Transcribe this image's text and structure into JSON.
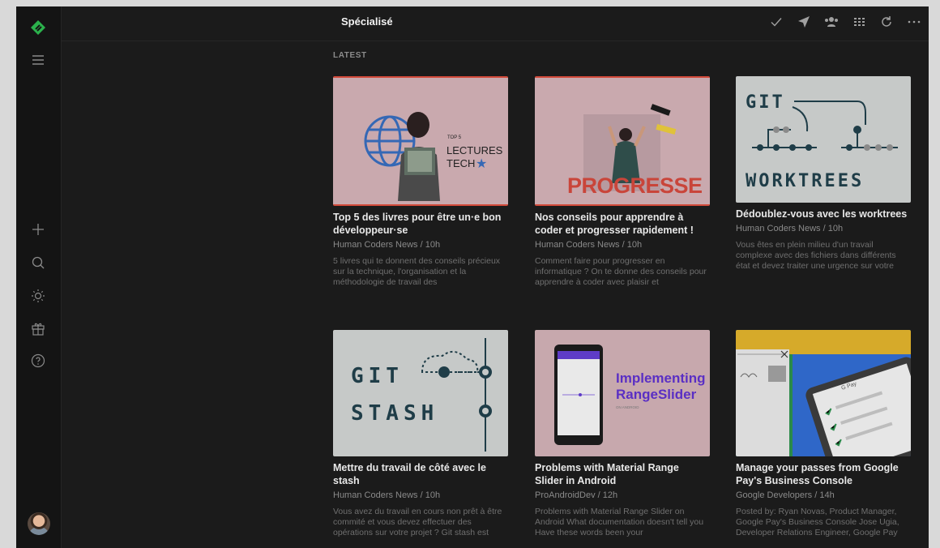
{
  "header": {
    "title": "Spécialisé"
  },
  "section": {
    "label": "LATEST"
  },
  "sidebar": {
    "icons": [
      "feedly-logo-icon",
      "menu-icon",
      "add-icon",
      "search-icon",
      "theme-icon",
      "gift-icon",
      "help-icon",
      "avatar"
    ]
  },
  "toolbar": {
    "icons": [
      "check-icon",
      "send-icon",
      "team-icon",
      "grid-view-icon",
      "refresh-icon",
      "more-icon"
    ]
  },
  "cards": [
    {
      "title": "Top 5 des livres pour être un·e bon développeur·se",
      "source": "Human Coders News / 10h",
      "desc": "5 livres qui te donnent des conseils précieux sur la technique, l'organisation et la méthodologie de travail des",
      "thumb": {
        "small": "TOP 5",
        "line1": "LECTURES",
        "line2": "TECH"
      }
    },
    {
      "title": "Nos conseils pour apprendre à coder et progresser rapidement !",
      "source": "Human Coders News / 10h",
      "desc": "Comment faire pour progresser en informatique ? On te donne des conseils pour apprendre à coder avec plaisir et",
      "thumb": {
        "word": "PROGRESSE"
      }
    },
    {
      "title": "Dédoublez-vous avec les worktrees",
      "source": "Human Coders News / 10h",
      "desc": "Vous êtes en plein milieu d'un travail complexe avec des fichiers dans différents état et devez traiter une urgence sur votre",
      "thumb": {
        "top": "GIT",
        "bottom": "WORKTREES"
      }
    },
    {
      "title": "Mettre du travail de côté avec le stash",
      "source": "Human Coders News / 10h",
      "desc": "Vous avez du travail en cours non prêt à être commité et vous devez effectuer des opérations sur votre projet ? Git stash est",
      "thumb": {
        "top": "GIT",
        "bottom": "STASH"
      }
    },
    {
      "title": "Problems with Material Range Slider in Android",
      "source": "ProAndroidDev / 12h",
      "desc": "Problems with Material Range Slider on Android What documentation doesn't tell you Have these words been your",
      "thumb": {
        "line1": "Implementing",
        "line2": "RangeSlider",
        "small": "ON ANDROID"
      }
    },
    {
      "title": "Manage your passes from Google Pay's Business Console",
      "source": "Google Developers / 14h",
      "desc": "Posted by: Ryan Novas, Product Manager, Google Pay's Business Console Jose Ugia, Developer Relations Engineer, Google Pay",
      "thumb": {
        "small": "G Pay"
      }
    }
  ]
}
